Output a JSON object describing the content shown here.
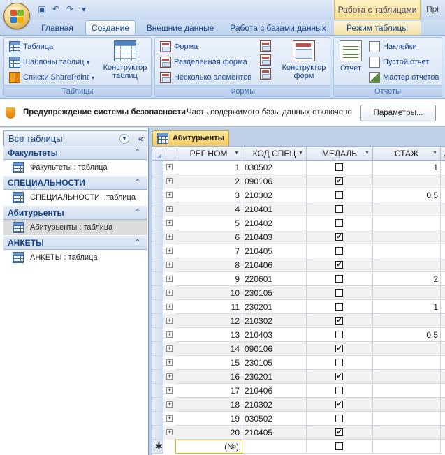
{
  "quick_access": {
    "icons": [
      "save-icon",
      "undo-icon",
      "redo-icon",
      "customize-icon"
    ]
  },
  "contextual_tab": {
    "title": "Работа с таблицами",
    "title_right": "Прі"
  },
  "tabs": [
    {
      "label": "Главная"
    },
    {
      "label": "Создание"
    },
    {
      "label": "Внешние данные"
    },
    {
      "label": "Работа с базами данных"
    },
    {
      "label": "Режим таблицы"
    }
  ],
  "ribbon": {
    "tables": {
      "label": "Таблицы",
      "table": "Таблица",
      "templates": "Шаблоны таблиц",
      "sharepoint": "Списки SharePoint",
      "designer_line1": "Конструктор",
      "designer_line2": "таблиц"
    },
    "forms": {
      "label": "Формы",
      "form": "Форма",
      "split": "Разделенная форма",
      "multiple": "Несколько элементов",
      "designer_line1": "Конструктор",
      "designer_line2": "форм"
    },
    "reports": {
      "label": "Отчеты",
      "report": "Отчет",
      "labels": "Наклейки",
      "blank": "Пустой отчет",
      "wizard": "Мастер отчетов"
    }
  },
  "security": {
    "title": "Предупреждение системы безопасности",
    "text": "Часть содержимого базы данных отключено",
    "button": "Параметры..."
  },
  "nav": {
    "header": "Все таблицы",
    "groups": [
      {
        "title": "Факультеты",
        "item": "Факультеты : таблица"
      },
      {
        "title": "СПЕЦИАЛЬНОСТИ",
        "item": "СПЕЦИАЛЬНОСТИ : таблица"
      },
      {
        "title": "Абитурьенты",
        "item": "Абитурьенты : таблица"
      },
      {
        "title": "АНКЕТЫ",
        "item": "АНКЕТЫ : таблица"
      }
    ]
  },
  "document": {
    "tab": "Абитурьенты",
    "columns": [
      "РЕГ НОМ",
      "КОД СПЕЦ",
      "МЕДАЛЬ",
      "СТАЖ",
      "Д"
    ],
    "rows": [
      {
        "reg": "1",
        "code": "030502",
        "medal": false,
        "stazh": "1"
      },
      {
        "reg": "2",
        "code": "090106",
        "medal": true,
        "stazh": ""
      },
      {
        "reg": "3",
        "code": "210302",
        "medal": false,
        "stazh": "0,5"
      },
      {
        "reg": "4",
        "code": "210401",
        "medal": false,
        "stazh": ""
      },
      {
        "reg": "5",
        "code": "210402",
        "medal": false,
        "stazh": ""
      },
      {
        "reg": "6",
        "code": "210403",
        "medal": true,
        "stazh": ""
      },
      {
        "reg": "7",
        "code": "210405",
        "medal": false,
        "stazh": ""
      },
      {
        "reg": "8",
        "code": "210406",
        "medal": true,
        "stazh": ""
      },
      {
        "reg": "9",
        "code": "220601",
        "medal": false,
        "stazh": "2"
      },
      {
        "reg": "10",
        "code": "230105",
        "medal": false,
        "stazh": ""
      },
      {
        "reg": "11",
        "code": "230201",
        "medal": false,
        "stazh": "1"
      },
      {
        "reg": "12",
        "code": "210302",
        "medal": true,
        "stazh": ""
      },
      {
        "reg": "13",
        "code": "210403",
        "medal": false,
        "stazh": "0,5"
      },
      {
        "reg": "14",
        "code": "090106",
        "medal": true,
        "stazh": ""
      },
      {
        "reg": "15",
        "code": "230105",
        "medal": false,
        "stazh": ""
      },
      {
        "reg": "16",
        "code": "230201",
        "medal": true,
        "stazh": ""
      },
      {
        "reg": "17",
        "code": "210406",
        "medal": false,
        "stazh": ""
      },
      {
        "reg": "18",
        "code": "210302",
        "medal": true,
        "stazh": ""
      },
      {
        "reg": "19",
        "code": "030502",
        "medal": false,
        "stazh": ""
      },
      {
        "reg": "20",
        "code": "210405",
        "medal": true,
        "stazh": ""
      }
    ],
    "new_row_value": "(№)"
  }
}
